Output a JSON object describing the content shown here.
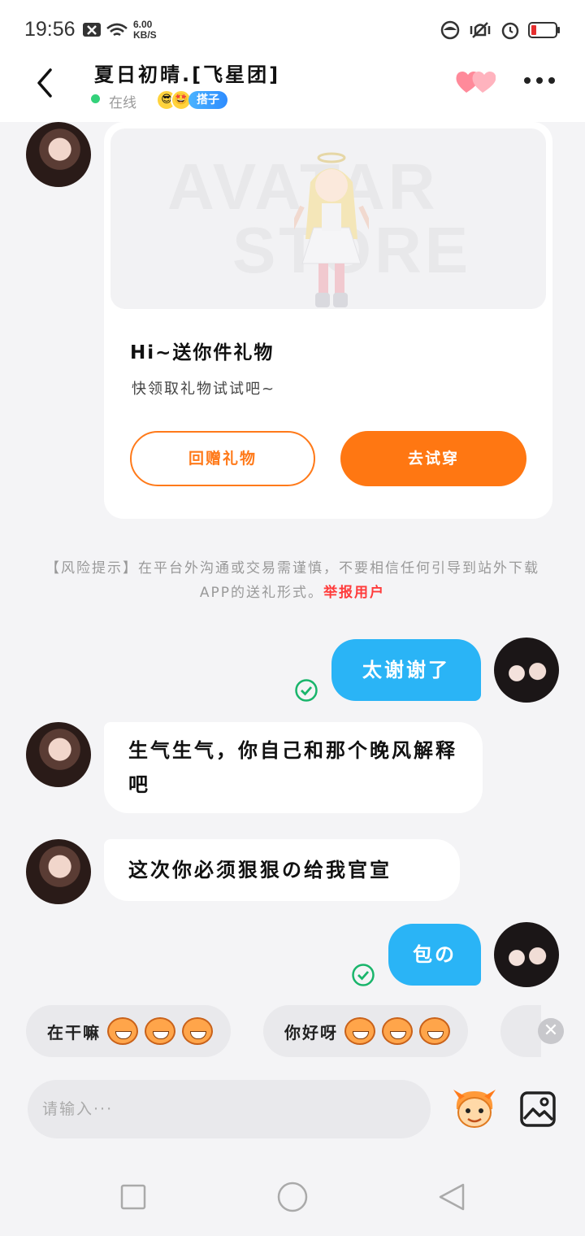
{
  "status_bar": {
    "time": "19:56",
    "net_speed_value": "6.00",
    "net_speed_unit": "KB/S",
    "icons": [
      "x-box-icon",
      "wifi-icon",
      "dnd-icon",
      "vibrate-icon",
      "alarm-icon",
      "battery-low-icon"
    ]
  },
  "header": {
    "title": "夏日初晴.[飞星团]",
    "status": "在线",
    "tag_label": "搭子"
  },
  "gift_card": {
    "watermark_line1": "AVATAR",
    "watermark_line2": "STORE",
    "title": "Hi~送你件礼物",
    "subtitle": "快领取礼物试试吧~",
    "return_gift_label": "回赠礼物",
    "try_on_label": "去试穿"
  },
  "risk_notice": {
    "text": "【风险提示】在平台外沟通或交易需谨慎，不要相信任何引导到站外下载APP的送礼形式。",
    "report_label": "举报用户"
  },
  "messages": [
    {
      "from": "me",
      "text": "太谢谢了"
    },
    {
      "from": "her",
      "text": "生气生气，你自己和那个晚风解释吧"
    },
    {
      "from": "her",
      "text": "这次你必须狠狠の给我官宣"
    },
    {
      "from": "me",
      "text": "包の"
    }
  ],
  "quick_replies": [
    {
      "text": "在干嘛"
    },
    {
      "text": "你好呀"
    }
  ],
  "input": {
    "placeholder": "请输入···"
  },
  "colors": {
    "accent_orange": "#ff7712",
    "bubble_blue": "#2ab4f6",
    "online_green": "#33d17a",
    "report_red": "#ff3b3b"
  }
}
